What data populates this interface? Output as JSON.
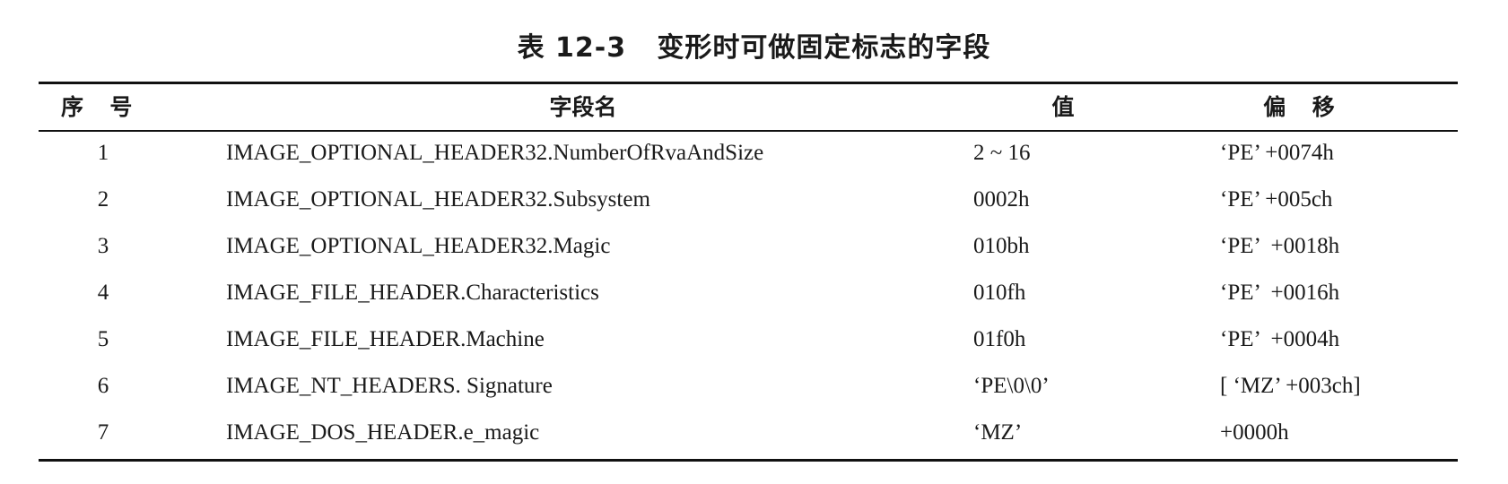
{
  "caption": "表 12-3   变形时可做固定标志的字段",
  "table": {
    "headers": {
      "index": "序  号",
      "field_name": "字段名",
      "value": "值",
      "offset": "偏  移"
    },
    "rows": [
      {
        "index": "1",
        "field_name": "IMAGE_OPTIONAL_HEADER32.NumberOfRvaAndSize",
        "value": "2 ~ 16",
        "offset": "‘PE’ +0074h"
      },
      {
        "index": "2",
        "field_name": "IMAGE_OPTIONAL_HEADER32.Subsystem",
        "value": "0002h",
        "offset": "‘PE’ +005ch"
      },
      {
        "index": "3",
        "field_name": "IMAGE_OPTIONAL_HEADER32.Magic",
        "value": "010bh",
        "offset": "‘PE’  +0018h"
      },
      {
        "index": "4",
        "field_name": "IMAGE_FILE_HEADER.Characteristics",
        "value": "010fh",
        "offset": "‘PE’  +0016h"
      },
      {
        "index": "5",
        "field_name": "IMAGE_FILE_HEADER.Machine",
        "value": "01f0h",
        "offset": "‘PE’  +0004h"
      },
      {
        "index": "6",
        "field_name": "IMAGE_NT_HEADERS. Signature",
        "value": "‘PE\\0\\0’",
        "offset": "[ ‘MZ’ +003ch]"
      },
      {
        "index": "7",
        "field_name": "IMAGE_DOS_HEADER.e_magic",
        "value": "‘MZ’",
        "offset": "+0000h"
      }
    ]
  }
}
